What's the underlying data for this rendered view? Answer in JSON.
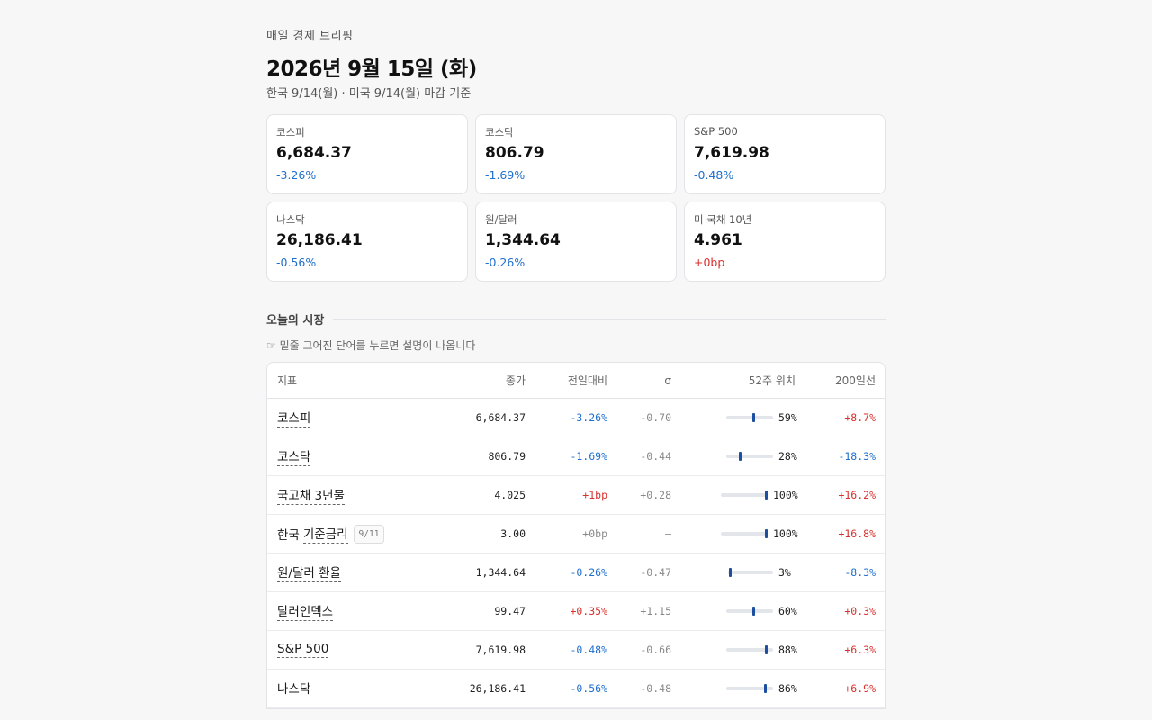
{
  "header": {
    "kicker": "매일 경제 브리핑",
    "title": "2026년 9월 15일 (화)",
    "subtitle": "한국 9/14(월) · 미국 9/14(월) 마감 기준"
  },
  "cards": [
    {
      "label": "코스피",
      "value": "6,684.37",
      "change": "-3.26%",
      "dir": "neg"
    },
    {
      "label": "코스닥",
      "value": "806.79",
      "change": "-1.69%",
      "dir": "neg"
    },
    {
      "label": "S&P 500",
      "value": "7,619.98",
      "change": "-0.48%",
      "dir": "neg"
    },
    {
      "label": "나스닥",
      "value": "26,186.41",
      "change": "-0.56%",
      "dir": "neg"
    },
    {
      "label": "원/달러",
      "value": "1,344.64",
      "change": "-0.26%",
      "dir": "neg"
    },
    {
      "label": "미 국채 10년",
      "value": "4.961",
      "change": "+0bp",
      "dir": "pos"
    }
  ],
  "section": {
    "title": "오늘의 시장",
    "hint": "☞ 밑줄 그어진 단어를 누르면 설명이 나옵니다"
  },
  "table": {
    "headers": {
      "name": "지표",
      "close": "종가",
      "change": "전일대비",
      "sigma": "σ",
      "range52": "52주 위치",
      "ma200": "200일선"
    },
    "rows": [
      {
        "name": "코스피",
        "close": "6,684.37",
        "change": "-3.26%",
        "change_dir": "neg",
        "sigma": "-0.70",
        "pos52": 0.59,
        "pos52_label": "59%",
        "ma200": "+8.7%",
        "ma200_dir": "pos"
      },
      {
        "name": "코스닥",
        "close": "806.79",
        "change": "-1.69%",
        "change_dir": "neg",
        "sigma": "-0.44",
        "pos52": 0.28,
        "pos52_label": "28%",
        "ma200": "-18.3%",
        "ma200_dir": "neg"
      },
      {
        "name": "국고채 3년물",
        "close": "4.025",
        "change": "+1bp",
        "change_dir": "pos",
        "sigma": "+0.28",
        "pos52": 1.0,
        "pos52_label": "100%",
        "ma200": "+16.2%",
        "ma200_dir": "pos"
      },
      {
        "name_prefix": "한국",
        "name": "기준금리",
        "badge": "9/11",
        "close": "3.00",
        "change": "+0bp",
        "change_dir": "neu",
        "sigma": "—",
        "pos52": 1.0,
        "pos52_label": "100%",
        "ma200": "+16.8%",
        "ma200_dir": "pos"
      },
      {
        "name": "원/달러 환율",
        "close": "1,344.64",
        "change": "-0.26%",
        "change_dir": "neg",
        "sigma": "-0.47",
        "pos52": 0.03,
        "pos52_label": "3%",
        "ma200": "-8.3%",
        "ma200_dir": "neg"
      },
      {
        "name": "달러인덱스",
        "close": "99.47",
        "change": "+0.35%",
        "change_dir": "pos",
        "sigma": "+1.15",
        "pos52": 0.6,
        "pos52_label": "60%",
        "ma200": "+0.3%",
        "ma200_dir": "pos"
      },
      {
        "name": "S&P 500",
        "close": "7,619.98",
        "change": "-0.48%",
        "change_dir": "neg",
        "sigma": "-0.66",
        "pos52": 0.88,
        "pos52_label": "88%",
        "ma200": "+6.3%",
        "ma200_dir": "pos"
      },
      {
        "name": "나스닥",
        "close": "26,186.41",
        "change": "-0.56%",
        "change_dir": "neg",
        "sigma": "-0.48",
        "pos52": 0.86,
        "pos52_label": "86%",
        "ma200": "+6.9%",
        "ma200_dir": "pos"
      }
    ]
  },
  "colors": {
    "negative": "#1f6fcf",
    "positive": "#d9302c",
    "neutral": "#888888",
    "range_marker": "#1c4fa0"
  }
}
